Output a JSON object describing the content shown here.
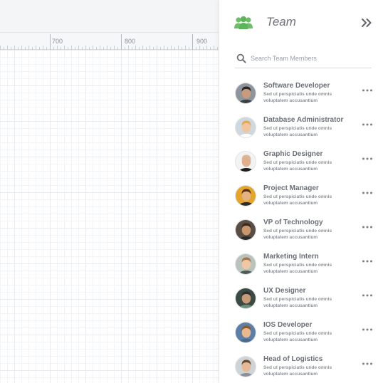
{
  "ruler": {
    "labels": [
      "700",
      "800",
      "900"
    ]
  },
  "panel": {
    "title": "Team",
    "icons": {
      "team": "team-icon",
      "collapse": "double-chevron-right-icon",
      "search": "search-icon",
      "more": "more-horizontal-icon"
    },
    "accent": "#6cbf67"
  },
  "search": {
    "placeholder": "Search Team Members",
    "value": ""
  },
  "members": [
    {
      "name": "Software Developer",
      "desc": "Sed ut perspiciatis unde omnis voluptatem accusantium",
      "skin": "#c99b7e",
      "hair": "#2b2420",
      "bg": "#8e959c",
      "shirt": "#3a3f46"
    },
    {
      "name": "Database Administrator",
      "desc": "Sed ut perspiciatis unde omnis voluptatem accusantium",
      "skin": "#f0c6a0",
      "hair": "#e2a85a",
      "bg": "#cfd8de",
      "shirt": "#ffffff"
    },
    {
      "name": "Graphic Designer",
      "desc": "Sed ut perspiciatis unde omnis voluptatem accusantium",
      "skin": "#e0b08e",
      "hair": "#d8b79b",
      "bg": "#f3f3f3",
      "shirt": "#1f1f1f"
    },
    {
      "name": "Project Manager",
      "desc": "Sed ut perspiciatis unde omnis voluptatem accusantium",
      "skin": "#e3b27f",
      "hair": "#5a3214",
      "bg": "#e3a52b",
      "shirt": "#2d2d2d"
    },
    {
      "name": "VP of Technology",
      "desc": "Sed ut perspiciatis unde omnis voluptatem accusantium",
      "skin": "#c9966d",
      "hair": "#3a2a1e",
      "bg": "#5a4e44",
      "shirt": "#2b2b2b"
    },
    {
      "name": "Marketing Intern",
      "desc": "Sed ut perspiciatis unde omnis voluptatem accusantium",
      "skin": "#efc7a6",
      "hair": "#a6764c",
      "bg": "#b9c2bb",
      "shirt": "#4d5b54"
    },
    {
      "name": "UX Designer",
      "desc": "Sed ut perspiciatis unde omnis voluptatem accusantium",
      "skin": "#c79a78",
      "hair": "#2e2e2e",
      "bg": "#3d4a44",
      "shirt": "#6b8f7a"
    },
    {
      "name": "IOS Developer",
      "desc": "Sed ut perspiciatis unde omnis voluptatem accusantium",
      "skin": "#e9b790",
      "hair": "#8a5a2c",
      "bg": "#5d7fa6",
      "shirt": "#4a6b8c"
    },
    {
      "name": "Head of Logistics",
      "desc": "Sed ut perspiciatis unde omnis voluptatem accusantium",
      "skin": "#e6b895",
      "hair": "#6a4a32",
      "bg": "#cfd3d6",
      "shirt": "#8a9199"
    }
  ]
}
